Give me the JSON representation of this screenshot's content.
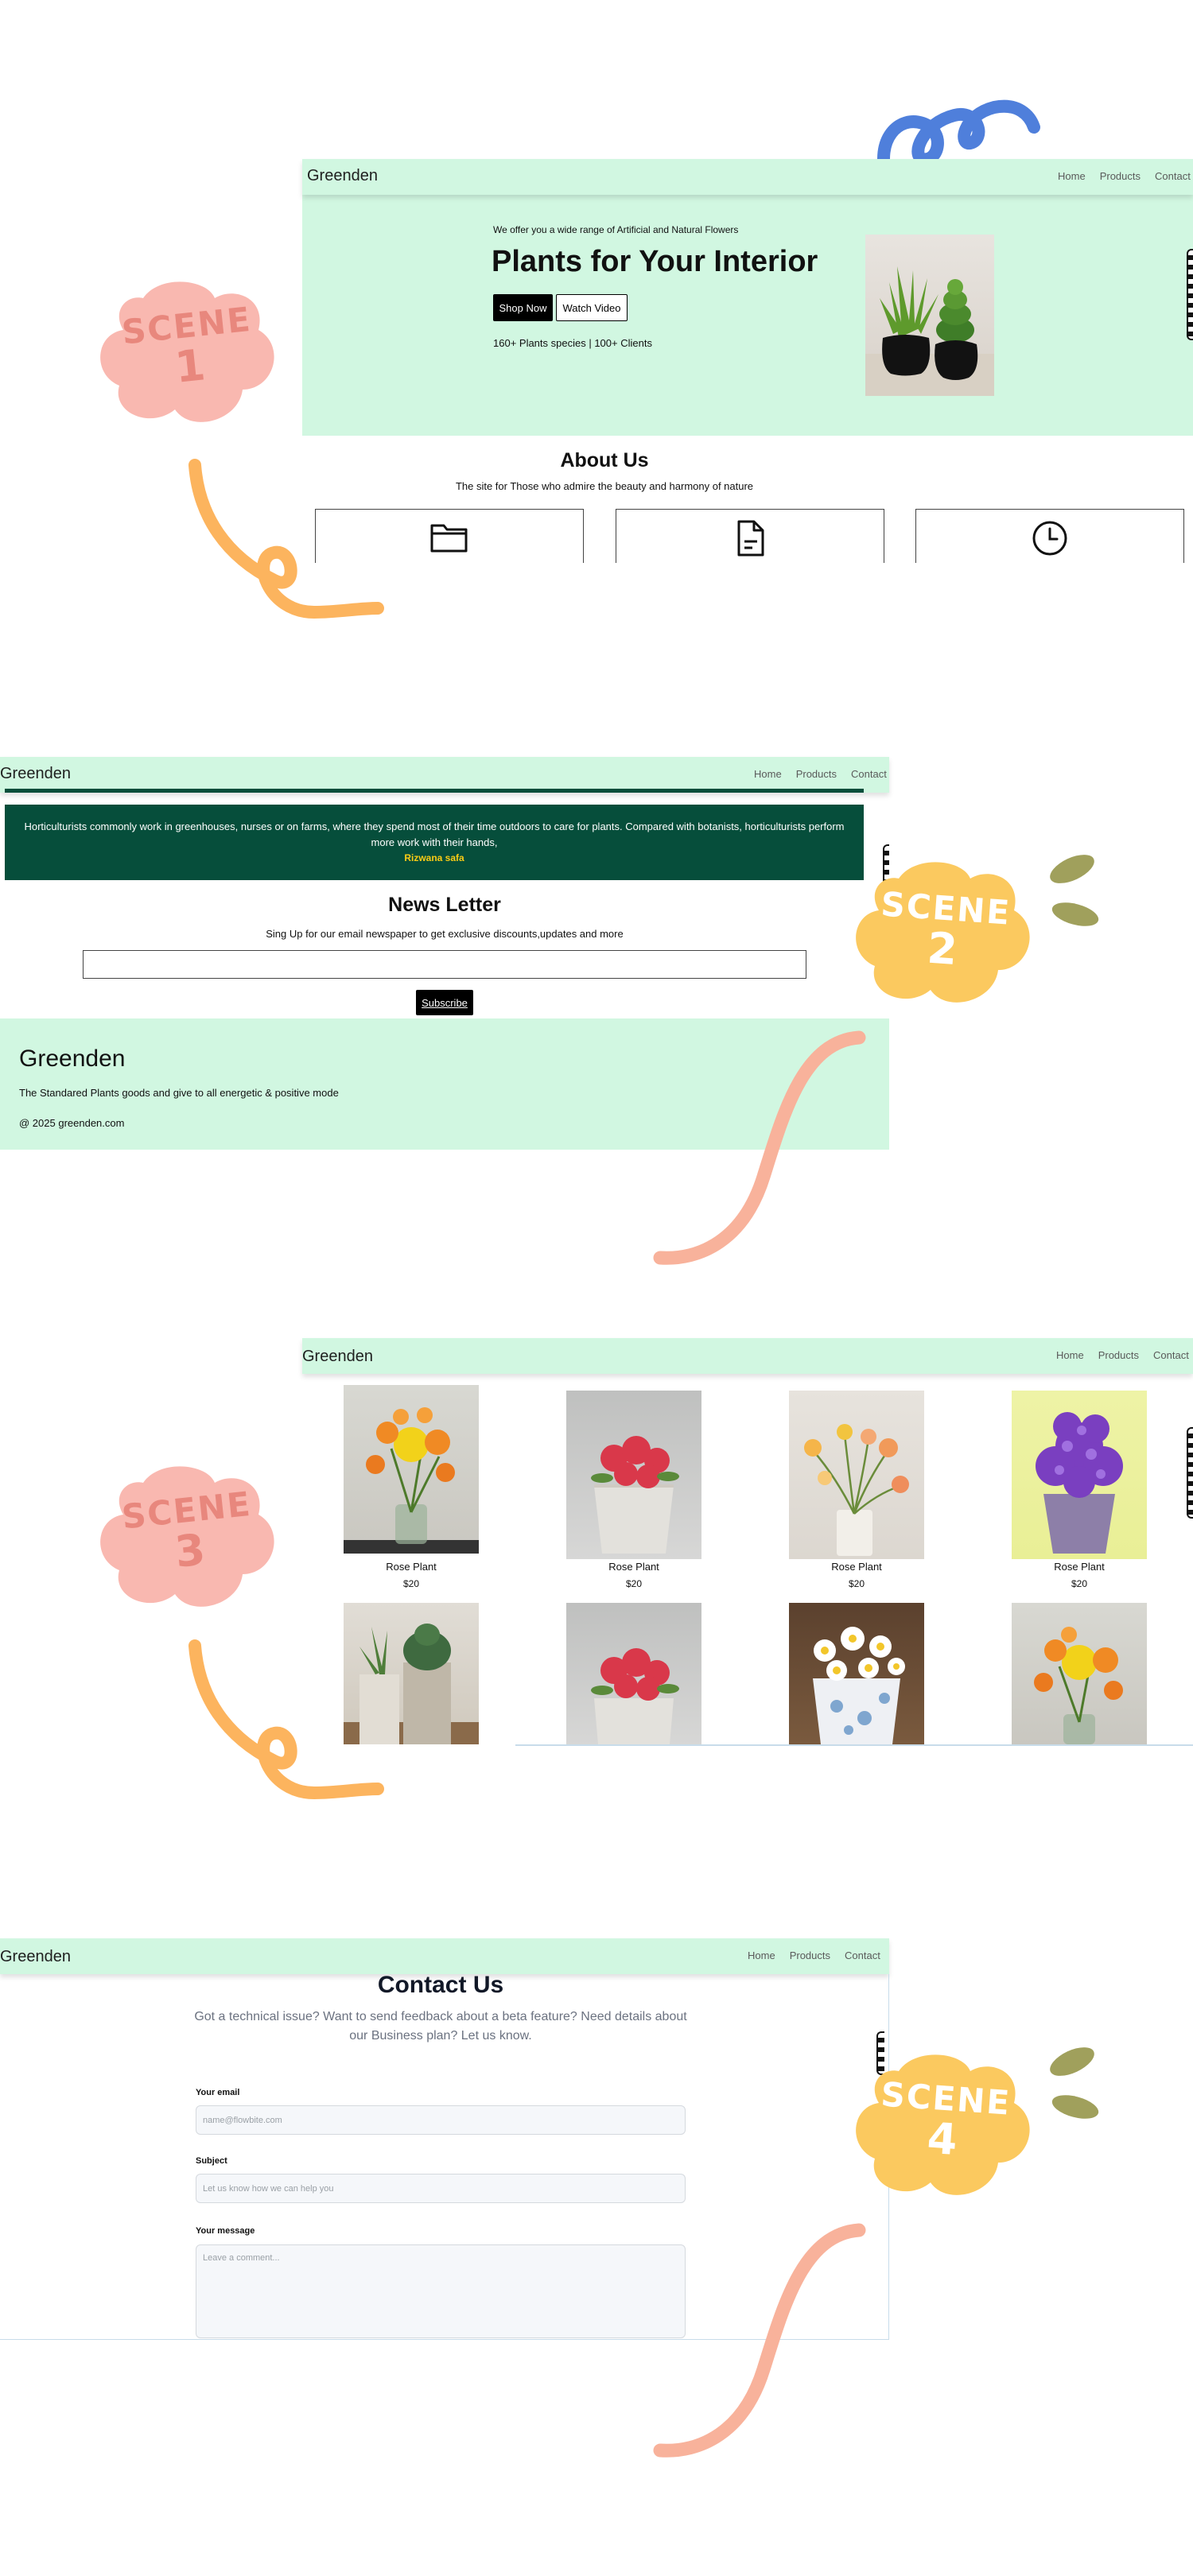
{
  "brand": "Greenden",
  "nav": {
    "home": "Home",
    "products": "Products",
    "contact": "Contact"
  },
  "scenes": {
    "s1": "SCENE",
    "n1": "1",
    "s2": "SCENE",
    "n2": "2",
    "s3": "SCENE",
    "n3": "3",
    "s4": "SCENE",
    "n4": "4"
  },
  "hero": {
    "tagline": "We offer you a wide range of Artificial and Natural Flowers",
    "title": "Plants for Your Interior",
    "shop_now": "Shop Now",
    "watch_video": "Watch Video",
    "stats": "160+ Plants species | 100+ Clients"
  },
  "about": {
    "title": "About Us",
    "subtitle": "The site for Those who admire the beauty and harmony of nature",
    "cards": [
      {
        "icon": "folder-icon"
      },
      {
        "icon": "document-icon"
      },
      {
        "icon": "clock-icon"
      }
    ]
  },
  "testimonial": {
    "text": "Horticulturists commonly work in greenhouses, nurses or on farms, where they spend most of their time outdoors to care for plants. Compared with botanists, horticulturists perform more work with their hands,",
    "author": "Rizwana safa"
  },
  "newsletter": {
    "title": "News Letter",
    "subtitle": "Sing Up for our email newspaper to get exclusive discounts,updates and more",
    "input_value": "",
    "subscribe": "Subscribe"
  },
  "footer": {
    "brand": "Greenden",
    "tagline": "The Standared Plants goods and give to all energetic & positive mode",
    "copyright": "@ 2025 greenden.com"
  },
  "products": [
    {
      "name": "Rose Plant",
      "price": "$20"
    },
    {
      "name": "Rose Plant",
      "price": "$20"
    },
    {
      "name": "Rose Plant",
      "price": "$20"
    },
    {
      "name": "Rose Plant",
      "price": "$20"
    }
  ],
  "contact": {
    "title": "Contact Us",
    "subtitle": "Got a technical issue? Want to send feedback about a beta feature? Need details about our Business plan? Let us know.",
    "email_label": "Your email",
    "email_placeholder": "name@flowbite.com",
    "subject_label": "Subject",
    "subject_placeholder": "Let us know how we can help you",
    "message_label": "Your message",
    "message_placeholder": "Leave a comment..."
  },
  "colors": {
    "mint": "#d1f7e1",
    "dark_green": "#064e3b",
    "author_yellow": "#facc15",
    "scene_pink": "#f9b8b0",
    "scene_yellow": "#fbc95f",
    "squiggle_blue": "#4f7fdb",
    "squiggle_orange": "#fcb45e",
    "squiggle_salmon": "#f8b29b",
    "leaf_olive": "#a0a05c"
  }
}
